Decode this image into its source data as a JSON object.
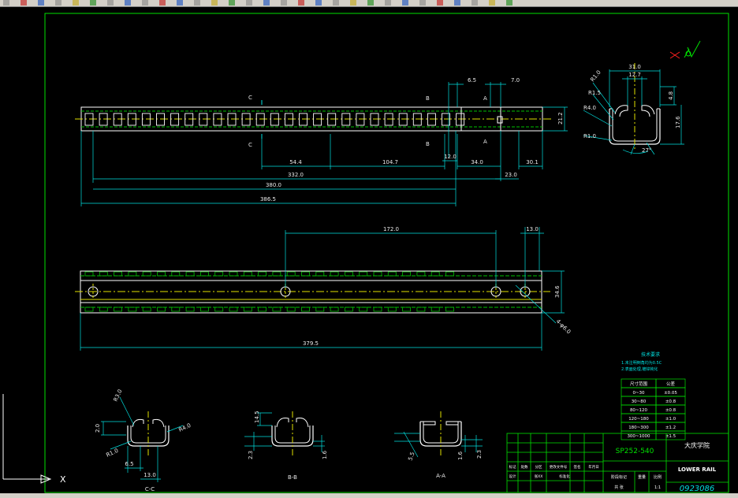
{
  "colors": {
    "frame": "#00e000",
    "dim": "#00e0e0",
    "outline": "#ffffff",
    "center": "#e0e000",
    "hidden": "#00c000",
    "annot": "#ff2020"
  },
  "top_view": {
    "dims_h": {
      "d1": "6.5",
      "d2": "7.0",
      "d3": "54.4",
      "d4": "104.7",
      "d5": "12.0",
      "d6": "34.0",
      "d7": "332.0",
      "d8": "23.0",
      "d9": "30.1",
      "d10": "380.0",
      "d11": "386.5"
    },
    "dim_v": "21.2",
    "labels": {
      "c_top": "C",
      "c_bot": "C",
      "b_top": "B",
      "b_bot": "B",
      "a_top": "A",
      "a_bot": "A"
    }
  },
  "front_view": {
    "d_spacing": "172.0",
    "d_edge": "13.0",
    "d_height": "34.6",
    "d_length": "379.5",
    "hole_label": "4-φ6.0"
  },
  "section_main": {
    "d_w": "31.0",
    "d_gap": "12.7",
    "d_h": "17.6",
    "d_lip": "4.8",
    "r1": "R1.0",
    "r2": "R1.5",
    "r3": "R4.0",
    "r4": "R1.0",
    "ang": "27°"
  },
  "section_cc": {
    "name": "C-C",
    "r_top": "R3.0",
    "r_right": "R4.0",
    "r_bot": "R1.0",
    "h": "2.0",
    "w1": "6.5",
    "w2": "13.0"
  },
  "section_bb": {
    "name": "B-B",
    "h1": "14.5",
    "h2": "2.3",
    "h3": "1.6"
  },
  "section_aa": {
    "name": "A-A",
    "h1": "5.5",
    "h2": "1.6",
    "h3": "2.3"
  },
  "notes": {
    "title": "技术要求",
    "line1": "1.未注明倒角均为0.5C",
    "line2": "2.表面处理,镀锌钝化"
  },
  "tolerance_table": {
    "header": [
      "尺寸范围",
      "公差"
    ],
    "rows": [
      [
        "0~30",
        "±0.05"
      ],
      [
        "30~80",
        "±0.8"
      ],
      [
        "80~120",
        "±0.8"
      ],
      [
        "120~180",
        "±1.0"
      ],
      [
        "180~300",
        "±1.2"
      ],
      [
        "300~1000",
        "±1.5"
      ]
    ]
  },
  "title_block": {
    "part_code": "SP252-540",
    "school": "大庆学院",
    "part_name": "LOWER RAIL",
    "drawing_no": "0923086",
    "row_labels": [
      "标记",
      "处数",
      "分区",
      "更改文件号",
      "签名",
      "年月日"
    ],
    "row2": [
      "设计",
      "张XX",
      "标准化"
    ],
    "col_labels": [
      "阶段标记",
      "重量",
      "比例"
    ],
    "scale": "1:1",
    "sheet": "共 张"
  },
  "ucs": {
    "x": "X",
    "y": "Y"
  }
}
